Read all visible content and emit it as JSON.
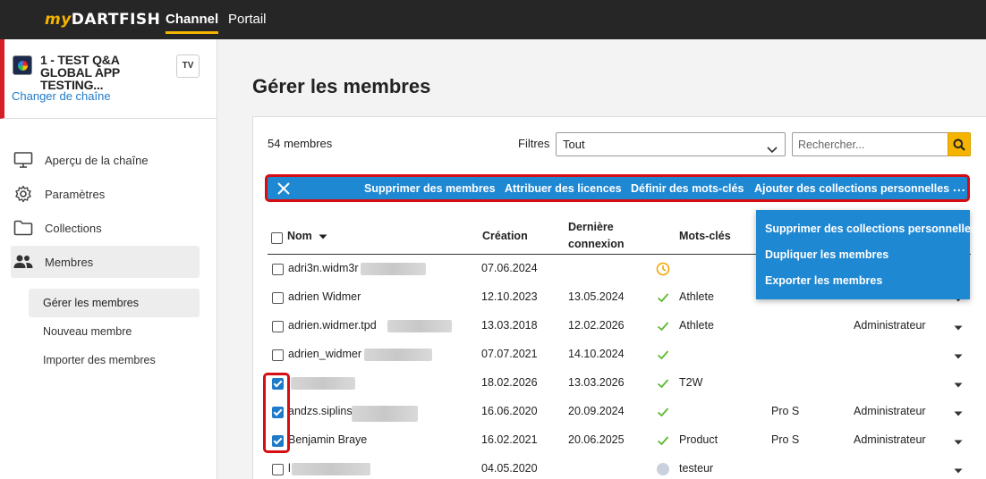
{
  "topbar": {
    "logo_my": "my",
    "logo_rest": "DARTFISH",
    "tabs": [
      {
        "label": "Channel",
        "active": true
      },
      {
        "label": "Portail",
        "active": false
      }
    ]
  },
  "sidebar": {
    "channel_name": "1 - TEST Q&A GLOBAL APP TESTING...",
    "tv_badge": "TV",
    "change_channel": "Changer de chaîne",
    "items": [
      {
        "label": "Aperçu de la chaîne",
        "icon": "monitor-icon"
      },
      {
        "label": "Paramètres",
        "icon": "gear-icon"
      },
      {
        "label": "Collections",
        "icon": "folder-icon"
      },
      {
        "label": "Membres",
        "icon": "users-icon",
        "active": true
      }
    ],
    "sub_items": [
      {
        "label": "Gérer les membres",
        "active": true
      },
      {
        "label": "Nouveau membre"
      },
      {
        "label": "Importer des membres"
      }
    ]
  },
  "main": {
    "title": "Gérer les membres",
    "member_count": "54 membres",
    "filters_label": "Filtres",
    "filter_value": "Tout",
    "search_placeholder": "Rechercher...",
    "actions": [
      "Supprimer des membres",
      "Attribuer des licences",
      "Définir des mots-clés",
      "Ajouter des collections personnelles"
    ],
    "more": "...",
    "dropdown": [
      "Supprimer des collections personnelles",
      "Dupliquer les membres",
      "Exporter les membres"
    ],
    "columns": {
      "nom": "Nom",
      "creation": "Création",
      "derniere_1": "Dernière",
      "derniere_2": "connexion",
      "mots_cles": "Mots-clés"
    },
    "rows": [
      {
        "name": "adri3n.widm3r",
        "created": "07.06.2024",
        "last": "",
        "status": "pending",
        "keyword": "",
        "license": "",
        "role": "",
        "checked": false
      },
      {
        "name": "adrien Widmer",
        "created": "12.10.2023",
        "last": "13.05.2024",
        "status": "ok",
        "keyword": "Athlete",
        "license": "",
        "role": "",
        "checked": false
      },
      {
        "name": "adrien.widmer.tpd",
        "created": "13.03.2018",
        "last": "12.02.2026",
        "status": "ok",
        "keyword": "Athlete",
        "license": "",
        "role": "Administrateur",
        "checked": false
      },
      {
        "name": "adrien_widmer",
        "created": "07.07.2021",
        "last": "14.10.2024",
        "status": "ok",
        "keyword": "",
        "license": "",
        "role": "",
        "checked": false
      },
      {
        "name": "",
        "created": "18.02.2026",
        "last": "13.03.2026",
        "status": "ok",
        "keyword": "T2W",
        "license": "",
        "role": "",
        "checked": true
      },
      {
        "name": "andzs.siplins",
        "created": "16.06.2020",
        "last": "20.09.2024",
        "status": "ok",
        "keyword": "",
        "license": "Pro S",
        "role": "Administrateur",
        "checked": true
      },
      {
        "name": "Benjamin Braye",
        "created": "16.02.2021",
        "last": "20.06.2025",
        "status": "ok",
        "keyword": "Product",
        "license": "Pro S",
        "role": "Administrateur",
        "checked": true
      },
      {
        "name": "l",
        "created": "04.05.2020",
        "last": "",
        "status": "inactive",
        "keyword": "testeur",
        "license": "",
        "role": "",
        "checked": false
      }
    ]
  },
  "colors": {
    "accent": "#f5b400",
    "action_blue": "#1f88d3",
    "highlight_red": "#d60d12",
    "link_blue": "#1f7ac9",
    "check_green": "#5cb82d"
  }
}
